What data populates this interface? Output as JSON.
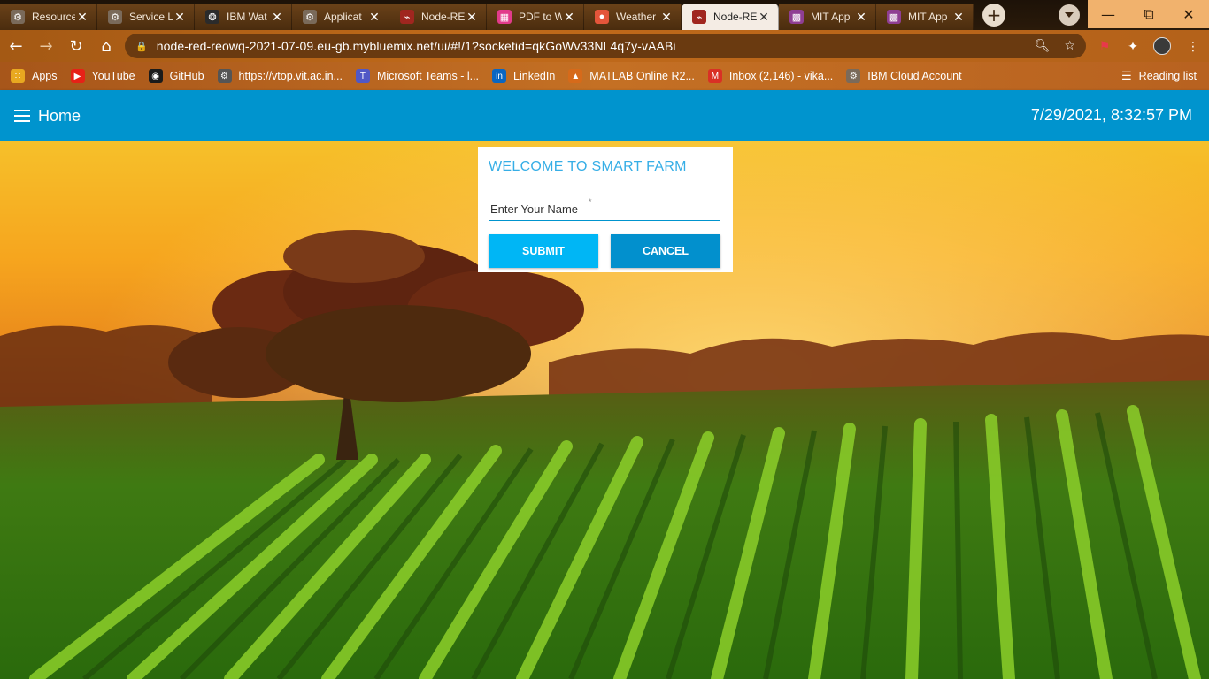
{
  "browser": {
    "tabs": [
      {
        "title": "Resource",
        "icon": "gear-icon",
        "color": "#7a6a5a"
      },
      {
        "title": "Service L",
        "icon": "gear-icon",
        "color": "#7a6a5a"
      },
      {
        "title": "IBM Wat",
        "icon": "bee-icon",
        "color": "#2b2b2b"
      },
      {
        "title": "Applicat",
        "icon": "gear-icon",
        "color": "#7a6a5a"
      },
      {
        "title": "Node-RE",
        "icon": "node-red-icon",
        "color": "#a0261f"
      },
      {
        "title": "PDF to W",
        "icon": "pdf-icon",
        "color": "#e23b8b"
      },
      {
        "title": "Weather",
        "icon": "weather-icon",
        "color": "#e4553a"
      },
      {
        "title": "Node-RE",
        "icon": "node-red-icon",
        "color": "#a0261f",
        "active": true
      },
      {
        "title": "MIT App",
        "icon": "mit-app-icon",
        "color": "#8f3e93"
      },
      {
        "title": "MIT App",
        "icon": "mit-app-icon",
        "color": "#8f3e93"
      }
    ],
    "url": "node-red-reowq-2021-07-09.eu-gb.mybluemix.net/ui/#!/1?socketid=qkGoWv33NL4q7y-vAABi",
    "bookmarks": [
      {
        "label": "Apps",
        "icon": "apps-grid-icon",
        "color": "#e8a820"
      },
      {
        "label": "YouTube",
        "icon": "youtube-icon",
        "color": "#e62117"
      },
      {
        "label": "GitHub",
        "icon": "github-icon",
        "color": "#1b1b1b"
      },
      {
        "label": "https://vtop.vit.ac.in...",
        "icon": "vtop-icon",
        "color": "#555555"
      },
      {
        "label": "Microsoft Teams - l...",
        "icon": "teams-icon",
        "color": "#5058c6"
      },
      {
        "label": "LinkedIn",
        "icon": "linkedin-icon",
        "color": "#0a66c2"
      },
      {
        "label": "MATLAB Online R2...",
        "icon": "matlab-icon",
        "color": "#d66a1a"
      },
      {
        "label": "Inbox (2,146) - vika...",
        "icon": "gmail-icon",
        "color": "#d93025"
      },
      {
        "label": "IBM Cloud Account",
        "icon": "gear-icon",
        "color": "#7a6a5a"
      }
    ],
    "reading_list": "Reading list"
  },
  "header": {
    "title": "Home",
    "datetime": "7/29/2021, 8:32:57 PM"
  },
  "dialog": {
    "title": "WELCOME TO SMART FARM",
    "name_placeholder": "Enter Your Name",
    "required_mark": "*",
    "submit_label": "SUBMIT",
    "cancel_label": "CANCEL"
  },
  "colors": {
    "header_bg": "#0094ce",
    "title_color": "#36aee6",
    "submit_bg": "#00b6f5",
    "cancel_bg": "#0290cd"
  }
}
